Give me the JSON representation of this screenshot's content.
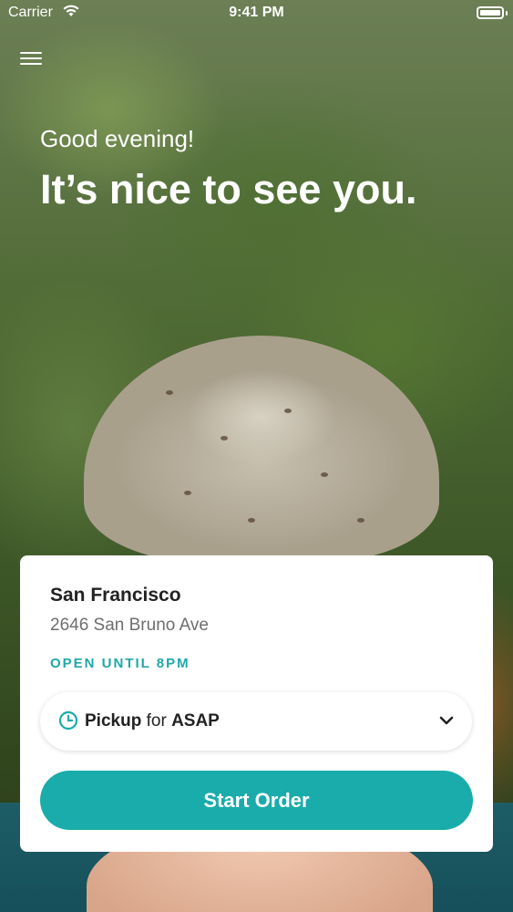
{
  "status_bar": {
    "carrier": "Carrier",
    "time": "9:41 PM"
  },
  "header": {
    "greeting": "Good evening!",
    "headline": "It’s nice to see you."
  },
  "store": {
    "name": "San Francisco",
    "address": "2646 San Bruno Ave",
    "hours": "OPEN UNTIL 8PM"
  },
  "pickup": {
    "mode": "Pickup",
    "connector": "for",
    "time": "ASAP"
  },
  "start_button": {
    "label": "Start Order"
  },
  "colors": {
    "accent": "#19acab",
    "hours_text": "#1fa8a8"
  },
  "icons": {
    "menu": "hamburger-menu-icon",
    "clock": "clock-icon",
    "chevron": "chevron-down-icon",
    "wifi": "wifi-icon",
    "battery": "battery-icon"
  }
}
